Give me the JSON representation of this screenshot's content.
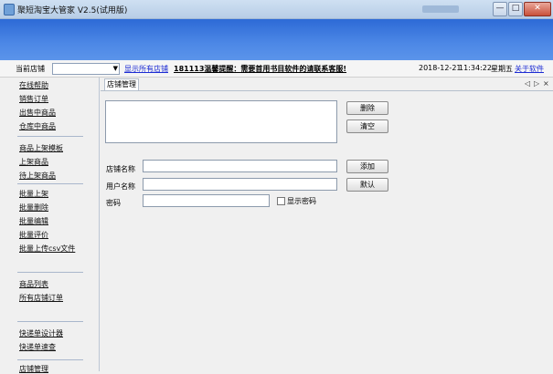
{
  "window": {
    "title": "聚短淘宝大管家 V2.5(试用版)",
    "min_glyph": "—",
    "max_glyph": "□",
    "close_glyph": "✕"
  },
  "toolbar": {
    "store_label": "当前店铺",
    "store_value": "",
    "show_all_stores": "显示所有店铺",
    "notice": "181113温馨提醒：需要首用书目软件的请联系客服!",
    "date": "2018-12-21",
    "time": "11:34:22",
    "weekday": "星期五",
    "about": "关于软件"
  },
  "sidebar": {
    "items": [
      "在线帮助",
      "销售订单",
      "出售中商品",
      "仓库中商品",
      "商品上架模板",
      "上架商品",
      "待上架商品",
      "批量上架",
      "批量删除",
      "批量编辑",
      "批量评价",
      "批量上传csv文件",
      "商品列表",
      "所有店铺订单",
      "快递单设计器",
      "快递单速查",
      "店铺管理"
    ]
  },
  "main": {
    "tab": "店铺管理",
    "tab_prev": "◁",
    "tab_next": "▷",
    "tab_close": "×",
    "buttons": {
      "delete": "删除",
      "clear": "清空",
      "add": "添加",
      "default": "默认"
    },
    "fields": {
      "store_name_label": "店铺名称",
      "user_name_label": "用户名称",
      "password_label": "密码",
      "show_password": "显示密码"
    }
  }
}
